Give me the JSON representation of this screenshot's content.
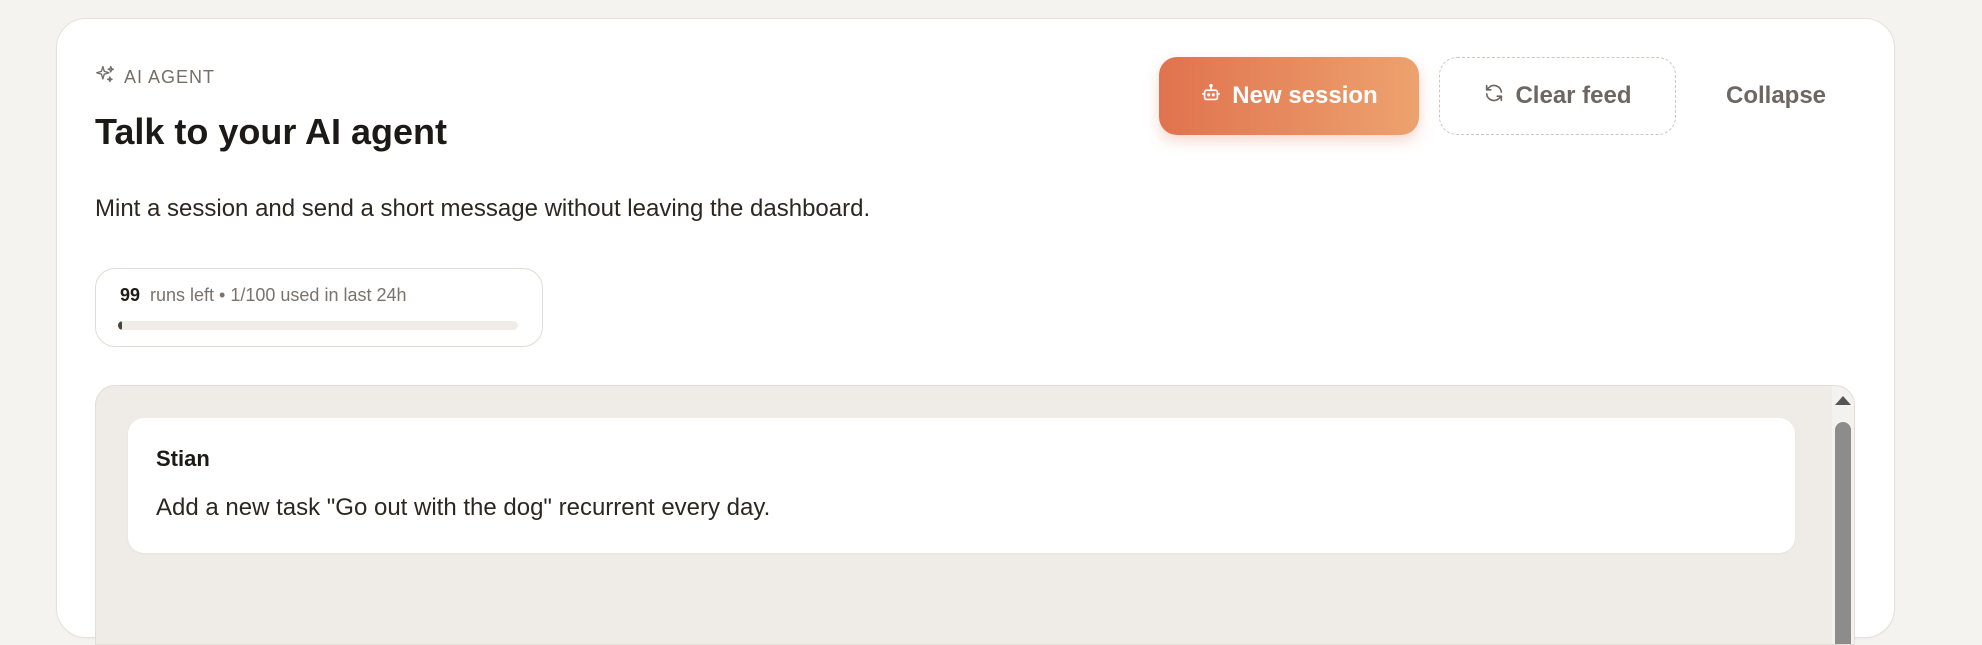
{
  "panel": {
    "eyebrow_icon": "sparkles-icon",
    "eyebrow": "AI AGENT",
    "title": "Talk to your AI agent",
    "description": "Mint a session and send a short message without leaving the dashboard."
  },
  "actions": {
    "new_session": {
      "icon": "robot-icon",
      "label": "New session"
    },
    "clear_feed": {
      "icon": "refresh-icon",
      "label": "Clear feed"
    },
    "collapse": {
      "label": "Collapse"
    }
  },
  "usage": {
    "runs_left": "99",
    "summary": "runs left • 1/100 used in last 24h",
    "used": 1,
    "limit": 100,
    "used_fraction": 0.01
  },
  "feed": {
    "messages": [
      {
        "author": "Stian",
        "text": "Add a new task \"Go out with the dog\" recurrent every day."
      }
    ]
  },
  "colors": {
    "accent_start": "#e0734f",
    "accent_end": "#eda26e",
    "card_background": "#ffffff",
    "feed_background": "#efebe6"
  }
}
